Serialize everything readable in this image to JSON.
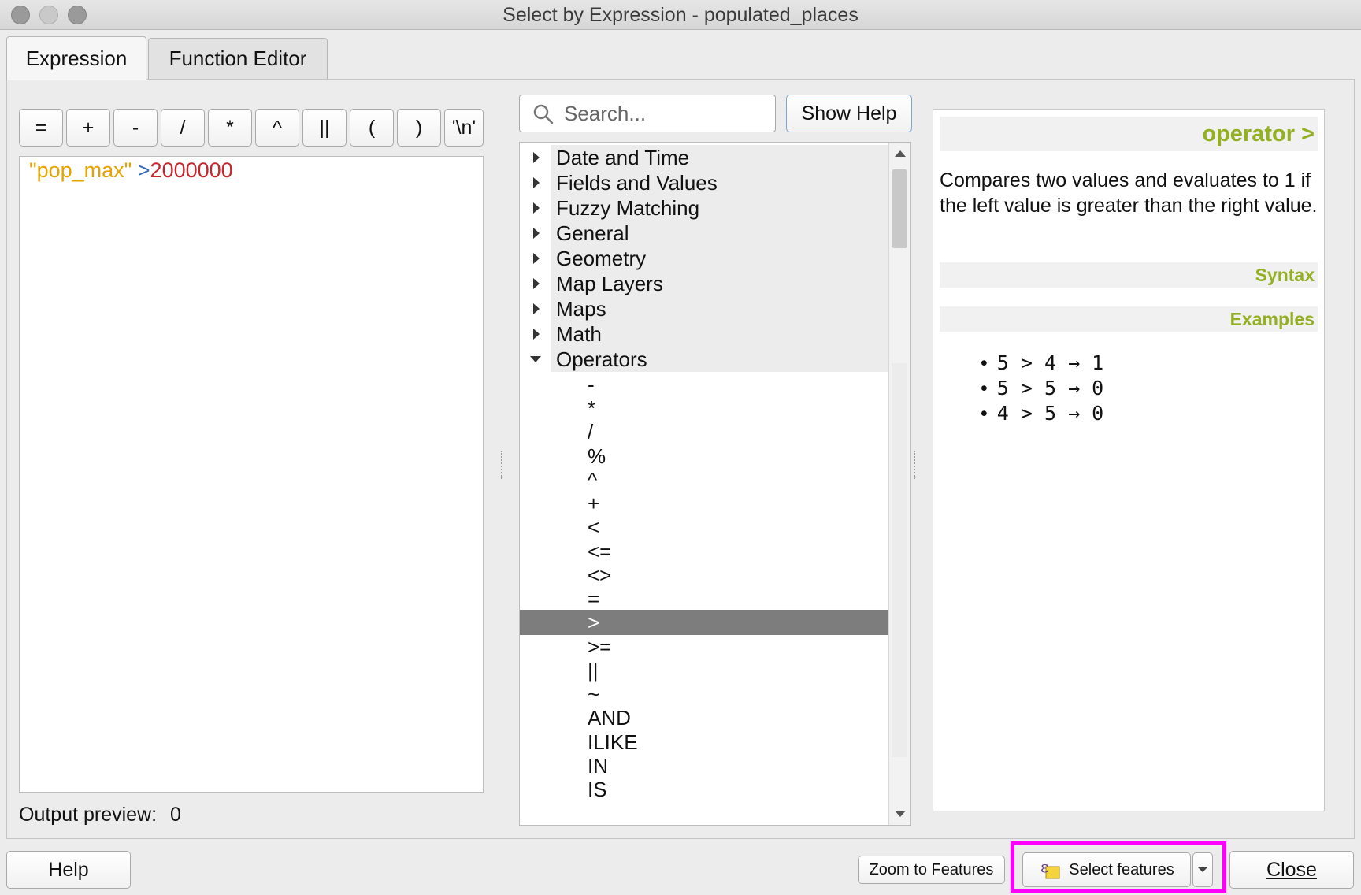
{
  "window": {
    "title": "Select by Expression - populated_places"
  },
  "tabs": [
    {
      "label": "Expression"
    },
    {
      "label": "Function Editor"
    }
  ],
  "operator_buttons": [
    "=",
    "+",
    "-",
    "/",
    "*",
    "^",
    "||",
    "(",
    ")",
    "'\\n'"
  ],
  "editor": {
    "field": "\"pop_max\"",
    "operator": ">",
    "value": "2000000"
  },
  "output_preview": {
    "label": "Output preview:",
    "value": "0"
  },
  "search": {
    "placeholder": "Search..."
  },
  "show_help_label": "Show Help",
  "tree": {
    "groups": [
      "Date and Time",
      "Fields and Values",
      "Fuzzy Matching",
      "General",
      "Geometry",
      "Map Layers",
      "Maps",
      "Math",
      "Operators"
    ],
    "operators": [
      "-",
      "*",
      "/",
      "%",
      "^",
      "+",
      "<",
      "<=",
      "<>",
      "=",
      ">",
      ">=",
      "||",
      "~",
      "AND",
      "ILIKE",
      "IN",
      "IS"
    ],
    "selected": ">"
  },
  "help": {
    "heading": "operator >",
    "description": "Compares two values and evaluates to 1 if the left value is greater than the right value.",
    "syntax_label": "Syntax",
    "examples_label": "Examples",
    "examples": [
      "5 > 4 → 1",
      "5 > 5 → 0",
      "4 > 5 → 0"
    ],
    "accent_color": "#93b023"
  },
  "footer": {
    "help_label": "Help",
    "zoom_label": "Zoom to Features",
    "select_label": "Select features",
    "close_label": "Close",
    "highlight_color": "#ff00ff"
  }
}
